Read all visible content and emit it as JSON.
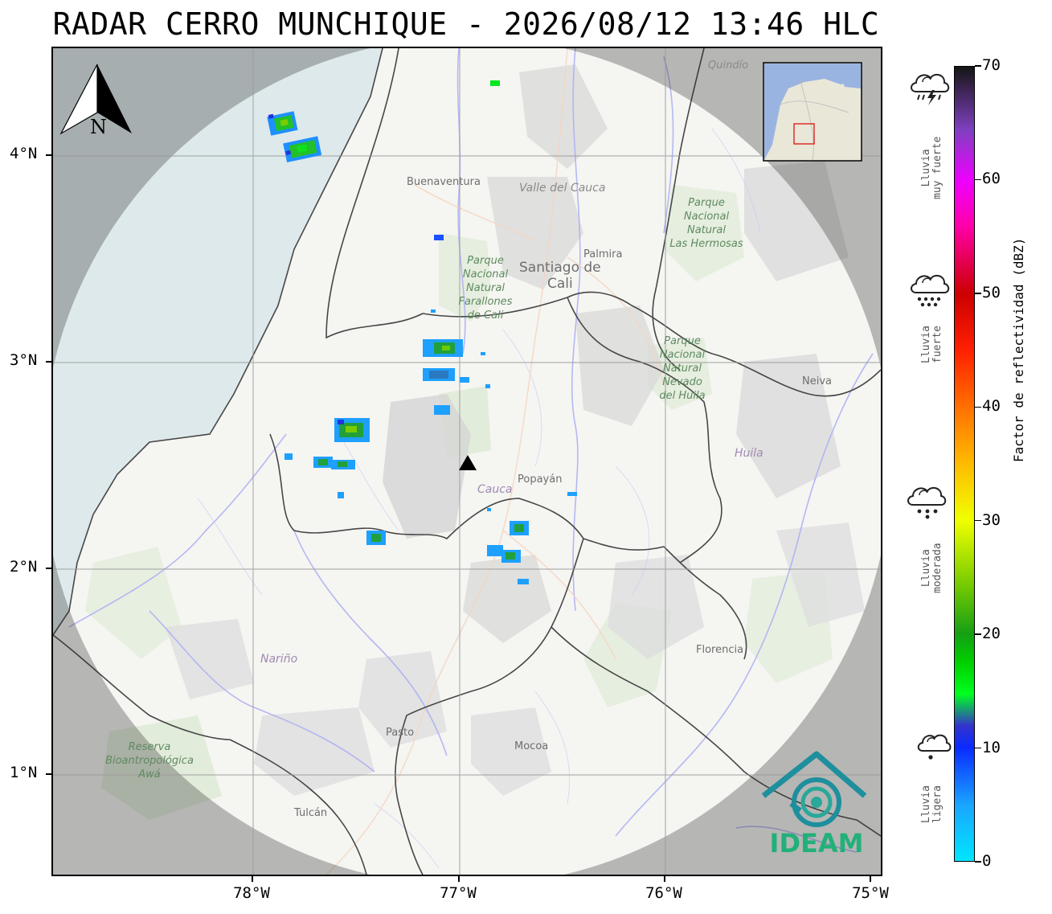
{
  "title": "RADAR CERRO MUNCHIQUE - 2026/08/12 13:46 HLC",
  "axes": {
    "lon_ticks": [
      "78°W",
      "77°W",
      "76°W",
      "75°W"
    ],
    "lat_ticks": [
      "4°N",
      "3°N",
      "2°N",
      "1°N"
    ]
  },
  "map_labels": {
    "buenaventura": "Buenaventura",
    "valle": "Valle del Cauca",
    "quindio": "Quindío",
    "palmira": "Palmira",
    "cali_1": "Santiago de",
    "cali_2": "Cali",
    "farallones": [
      "Parque",
      "Nacional",
      "Natural",
      "Farallones",
      "de Cali"
    ],
    "hermosas": [
      "Parque",
      "Nacional",
      "Natural",
      "Las Hermosas"
    ],
    "nevado": [
      "Parque",
      "Nacional",
      "Natural",
      "Nevado",
      "del Huila"
    ],
    "neiva": "Neiva",
    "huila": "Huila",
    "cauca": "Cauca",
    "popayan": "Popayán",
    "narino": "Nariño",
    "florencia": "Florencia",
    "pasto": "Pasto",
    "mocoa": "Mocoa",
    "tulcan": "Tulcán",
    "awa": [
      "Reserva",
      "Bioantropológica",
      "Awá"
    ]
  },
  "north_arrow": "N",
  "logo_text": "IDEAM",
  "colorbar": {
    "title": "Factor de reflectividad (dBZ)",
    "ticks": [
      0,
      10,
      20,
      30,
      40,
      50,
      60,
      70
    ],
    "min": 0,
    "max": 70
  },
  "legend": [
    {
      "label": "Lluvia muy fuerte",
      "lines": [
        "Lluvia",
        "muy fuerte"
      ],
      "icon": "storm-cloud-icon"
    },
    {
      "label": "Lluvia fuerte",
      "lines": [
        "Lluvia",
        "fuerte"
      ],
      "icon": "heavy-rain-cloud-icon"
    },
    {
      "label": "Lluvia moderada",
      "lines": [
        "Lluvia",
        "moderada"
      ],
      "icon": "moderate-rain-cloud-icon"
    },
    {
      "label": "Lluvia ligera",
      "lines": [
        "Lluvia",
        "ligera"
      ],
      "icon": "light-rain-cloud-icon"
    }
  ],
  "colors": {
    "radar_coverage": "#f6f5f3",
    "outside_coverage": "#a9adad",
    "ocean": "#d6e4e6",
    "logo": "#1e8f9d",
    "radar_site": "#000000"
  }
}
